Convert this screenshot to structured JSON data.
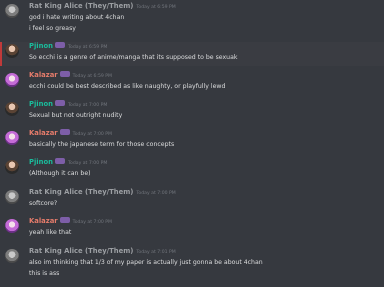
{
  "messages": [
    {
      "user": "Rat King Alice (They/Them)",
      "user_class": "ratking",
      "avatar": "ratking",
      "tag": false,
      "timestamp": "Today at 6:59 PM",
      "lines": [
        "god i hate writing about 4chan",
        "i feel so greasy"
      ]
    },
    {
      "user": "Pjinon",
      "user_class": "pjinon",
      "avatar": "pjinon",
      "tag": true,
      "timestamp": "Today at 6:59 PM",
      "lines": [
        "So ecchi is a genre of anime/manga that its supposed to be sexuak"
      ],
      "highlight": true
    },
    {
      "user": "Kalazar",
      "user_class": "kalazar",
      "avatar": "kalazar",
      "tag": true,
      "timestamp": "Today at 6:59 PM",
      "lines": [
        "ecchi could be best described as like naughty, or playfully lewd"
      ]
    },
    {
      "user": "Pjinon",
      "user_class": "pjinon",
      "avatar": "pjinon",
      "tag": true,
      "timestamp": "Today at 7:00 PM",
      "lines": [
        "Sexual but not outright nudity"
      ]
    },
    {
      "user": "Kalazar",
      "user_class": "kalazar",
      "avatar": "kalazar",
      "tag": true,
      "timestamp": "Today at 7:00 PM",
      "lines": [
        "basically the japanese term for those concepts"
      ]
    },
    {
      "user": "Pjinon",
      "user_class": "pjinon",
      "avatar": "pjinon",
      "tag": true,
      "timestamp": "Today at 7:00 PM",
      "lines": [
        "(Although it can be)"
      ]
    },
    {
      "user": "Rat King Alice (They/Them)",
      "user_class": "ratking",
      "avatar": "ratking",
      "tag": false,
      "timestamp": "Today at 7:00 PM",
      "lines": [
        "softcore?"
      ]
    },
    {
      "user": "Kalazar",
      "user_class": "kalazar",
      "avatar": "kalazar",
      "tag": true,
      "timestamp": "Today at 7:00 PM",
      "lines": [
        "yeah like that"
      ]
    },
    {
      "user": "Rat King Alice (They/Them)",
      "user_class": "ratking",
      "avatar": "ratking",
      "tag": false,
      "timestamp": "Today at 7:01 PM",
      "lines": [
        "also im thinking that 1/3 of my paper is actually just gonna be about 4chan",
        "this is ass"
      ]
    }
  ]
}
